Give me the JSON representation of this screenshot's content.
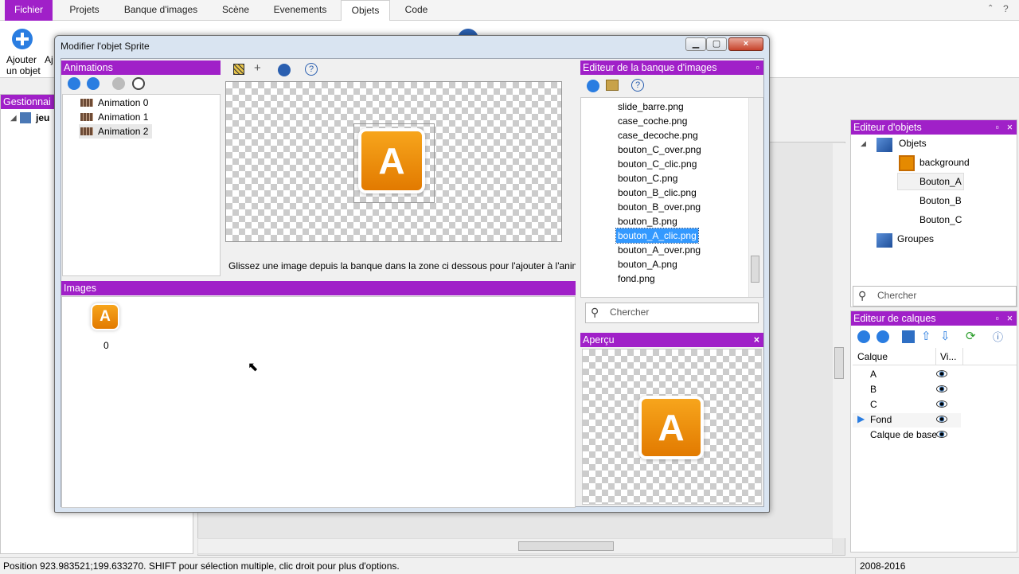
{
  "tabs": [
    "Fichier",
    "Projets",
    "Banque d'images",
    "Scène",
    "Evenements",
    "Objets",
    "Code"
  ],
  "ribbon": {
    "add_object_line1": "Ajouter",
    "add_object_line2": "un objet",
    "partial_label": "Aj"
  },
  "project_panel": {
    "title": "Gestionnai",
    "root_item": "jeu"
  },
  "dialog": {
    "title": "Modifier l'objet Sprite",
    "animations_header": "Animations",
    "animations": [
      "Animation 0",
      "Animation 1",
      "Animation 2"
    ],
    "drop_hint": "Glissez une image depuis la banque dans la zone ci dessous pour l'ajouter à l'anima",
    "images_header": "Images",
    "images": [
      {
        "index": "0",
        "glyph": "A"
      }
    ],
    "sprite_glyph": "A",
    "bank_header": "Editeur de la banque d'images",
    "bank_files": [
      "slide_barre.png",
      "case_coche.png",
      "case_decoche.png",
      "bouton_C_over.png",
      "bouton_C_clic.png",
      "bouton_C.png",
      "bouton_B_clic.png",
      "bouton_B_over.png",
      "bouton_B.png",
      "bouton_A_clic.png",
      "bouton_A_over.png",
      "bouton_A.png",
      "fond.png"
    ],
    "bank_selected": "bouton_A_clic.png",
    "bank_search_placeholder": "Chercher",
    "preview_header": "Aperçu",
    "close_glyph": "×"
  },
  "object_editor": {
    "title": "Editeur d'objets",
    "root": "Objets",
    "items": [
      "background",
      "Bouton_A",
      "Bouton_B",
      "Bouton_C"
    ],
    "selected": "Bouton_A",
    "groups": "Groupes",
    "search_placeholder": "Chercher"
  },
  "layer_editor": {
    "title": "Editeur de calques",
    "col_layer": "Calque",
    "col_visible": "Vi...",
    "layers": [
      "A",
      "B",
      "C",
      "Fond",
      "Calque de base"
    ],
    "current": "Fond"
  },
  "status": {
    "text": "Position 923.983521;199.633270. SHIFT pour sélection multiple, clic droit pour plus d'options.",
    "right": "2008-2016"
  },
  "colors": {
    "accent": "#a020c8",
    "selection": "#3399ff",
    "sprite_orange": "#f39200"
  }
}
